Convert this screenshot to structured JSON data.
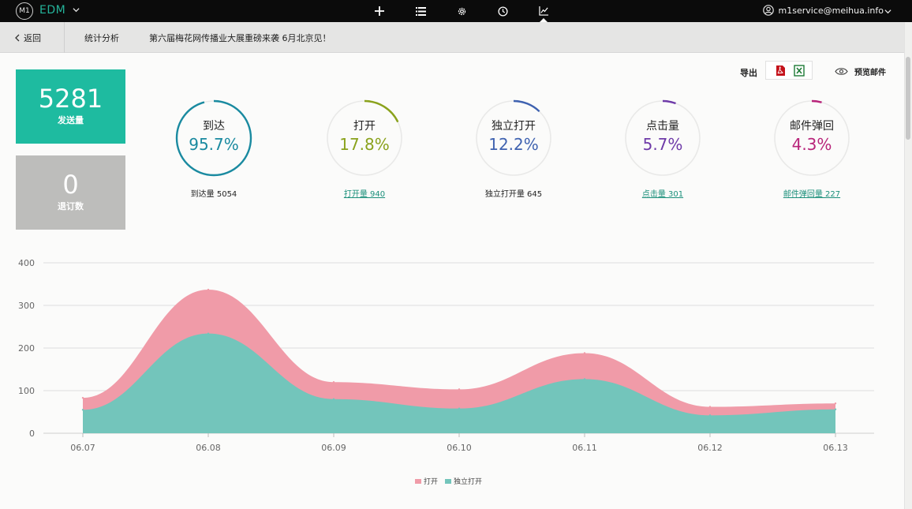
{
  "topbar": {
    "logo_text": "M1",
    "app_name": "EDM",
    "nav_icons": [
      "plus-icon",
      "list-icon",
      "gear-icon",
      "clock-icon",
      "chart-icon"
    ],
    "active_nav": "chart-icon",
    "user_email": "m1service@meihua.info"
  },
  "subbar": {
    "back_label": "返回",
    "tab_label": "统计分析",
    "campaign_title": "第六届梅花网传播业大展重磅来袭 6月北京见！"
  },
  "stats": {
    "sent": {
      "value": "5281",
      "label": "发送量",
      "color": "#1ebba0"
    },
    "unsubscribed": {
      "value": "0",
      "label": "退订数",
      "color": "#bdbdbb"
    }
  },
  "export": {
    "label": "导出",
    "pdf_icon": "pdf-icon",
    "excel_icon": "excel-icon",
    "preview_label": "预览邮件"
  },
  "metrics": [
    {
      "name": "到达",
      "value": "95.7%",
      "fraction": 0.957,
      "count_label": "到达量 5054",
      "link": false,
      "color": "#1a8aa0"
    },
    {
      "name": "打开",
      "value": "17.8%",
      "fraction": 0.178,
      "count_label": "打开量 940",
      "link": true,
      "color": "#8aa21c"
    },
    {
      "name": "独立打开",
      "value": "12.2%",
      "fraction": 0.122,
      "count_label": "独立打开量 645",
      "link": false,
      "color": "#3f62b0"
    },
    {
      "name": "点击量",
      "value": "5.7%",
      "fraction": 0.057,
      "count_label": "点击量 301",
      "link": true,
      "color": "#6e3aa8"
    },
    {
      "name": "邮件弹回",
      "value": "4.3%",
      "fraction": 0.043,
      "count_label": "邮件弹回量 227",
      "link": true,
      "color": "#b8247a"
    }
  ],
  "chart_data": {
    "type": "area",
    "stacked": false,
    "categories": [
      "06.07",
      "06.08",
      "06.09",
      "06.10",
      "06.11",
      "06.12",
      "06.13"
    ],
    "ylim": [
      0,
      400
    ],
    "yticks": [
      0,
      100,
      200,
      300,
      400
    ],
    "grid": true,
    "legend_position": "bottom-center",
    "series": [
      {
        "name": "打开",
        "color": "#f09ba8",
        "values": [
          83,
          337,
          120,
          103,
          188,
          62,
          70
        ]
      },
      {
        "name": "独立打开",
        "color": "#73c5bb",
        "values": [
          55,
          234,
          80,
          58,
          127,
          42,
          56
        ]
      }
    ]
  }
}
